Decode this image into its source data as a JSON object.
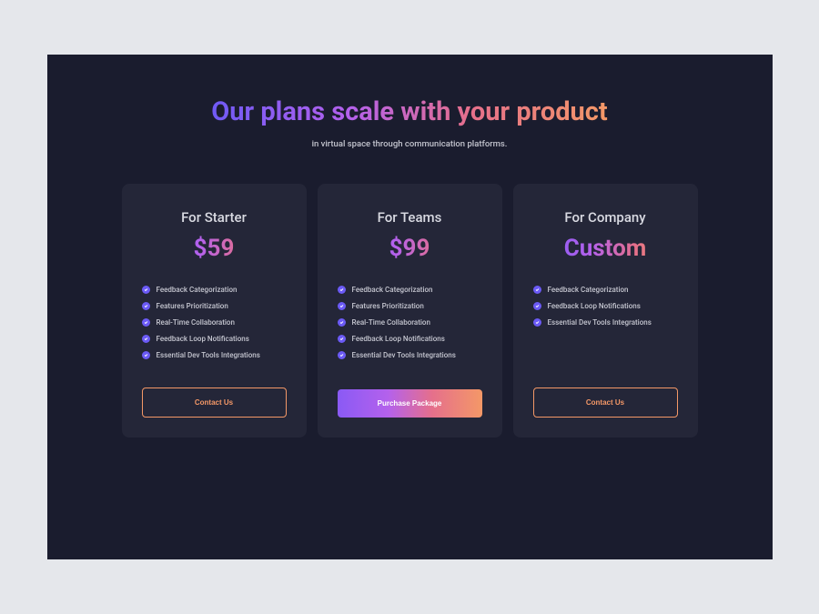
{
  "header": {
    "title": "Our plans scale with your product",
    "subtitle": "in virtual space through communication platforms."
  },
  "plans": [
    {
      "name": "For Starter",
      "price": "$59",
      "features": [
        "Feedback Categorization",
        "Features Prioritization",
        "Real-Time Collaboration",
        "Feedback Loop Notifications",
        "Essential Dev Tools Integrations"
      ],
      "cta": "Contact Us",
      "ctaStyle": "outline"
    },
    {
      "name": "For Teams",
      "price": "$99",
      "features": [
        "Feedback Categorization",
        "Features Prioritization",
        "Real-Time Collaboration",
        "Feedback Loop Notifications",
        "Essential Dev Tools Integrations"
      ],
      "cta": "Purchase Package",
      "ctaStyle": "filled"
    },
    {
      "name": "For Company",
      "price": "Custom",
      "features": [
        "Feedback Categorization",
        "Feedback Loop Notifications",
        "Essential Dev Tools Integrations"
      ],
      "cta": "Contact Us",
      "ctaStyle": "outline"
    }
  ]
}
